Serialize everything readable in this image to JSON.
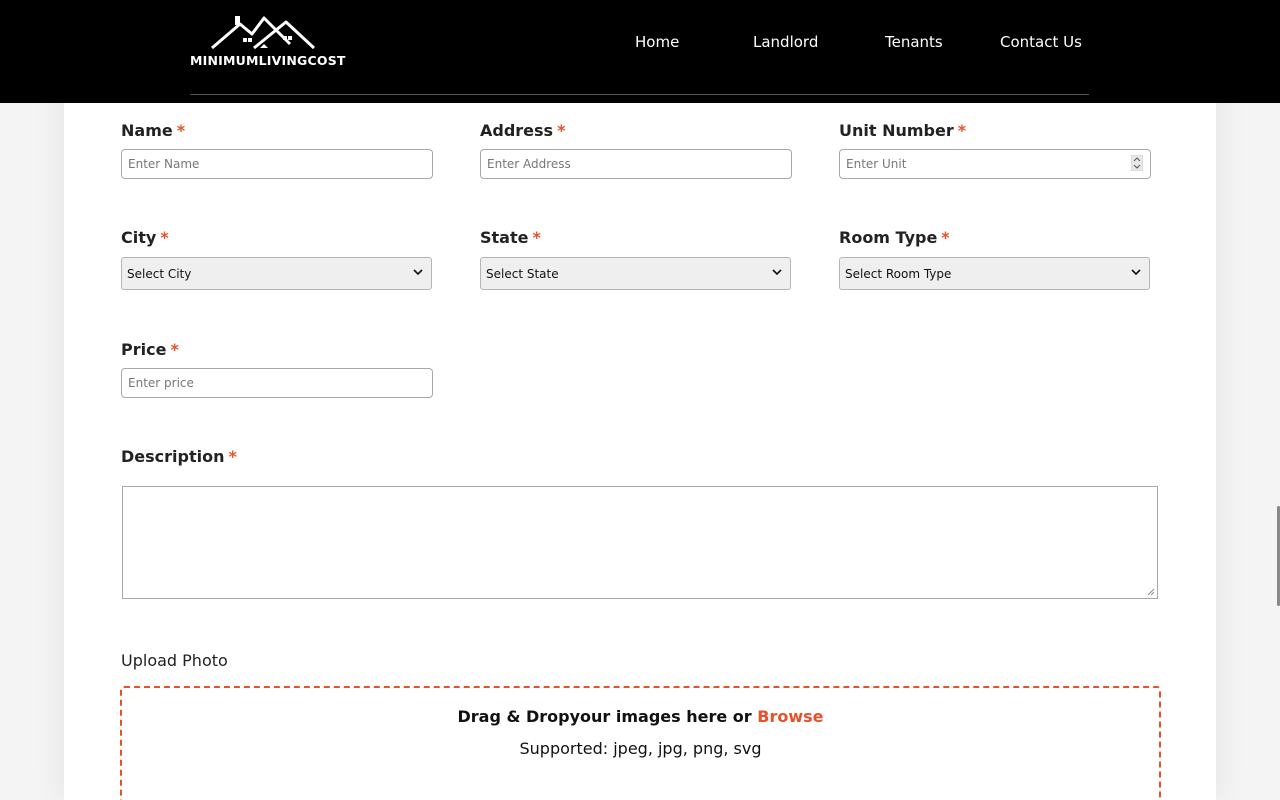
{
  "header": {
    "logo_text": "MINIMUMLIVINGCOST",
    "nav": [
      {
        "label": "Home"
      },
      {
        "label": "Landlord"
      },
      {
        "label": "Tenants"
      },
      {
        "label": "Contact Us"
      }
    ]
  },
  "form": {
    "required_mark": "*",
    "name": {
      "label": "Name",
      "placeholder": "Enter Name"
    },
    "address": {
      "label": "Address",
      "placeholder": "Enter Address"
    },
    "unit": {
      "label": "Unit Number",
      "placeholder": "Enter Unit"
    },
    "city": {
      "label": "City",
      "selected": "Select City"
    },
    "state": {
      "label": "State",
      "selected": "Select State"
    },
    "room_type": {
      "label": "Room Type",
      "selected": "Select Room Type"
    },
    "price": {
      "label": "Price",
      "placeholder": "Enter price"
    },
    "description": {
      "label": "Description",
      "value": ""
    },
    "upload": {
      "label": "Upload Photo",
      "drag_text": "Drag & Dropyour images here or",
      "browse_label": "Browse",
      "supported_text": "Supported: jpeg, jpg, png, svg"
    }
  },
  "colors": {
    "accent": "#e8522b",
    "header_bg": "#000000",
    "page_bg": "#ffffff"
  },
  "icons": [
    "house-logo-icon",
    "chevron-down-icon",
    "number-spinner-icon",
    "resize-grip-icon"
  ]
}
